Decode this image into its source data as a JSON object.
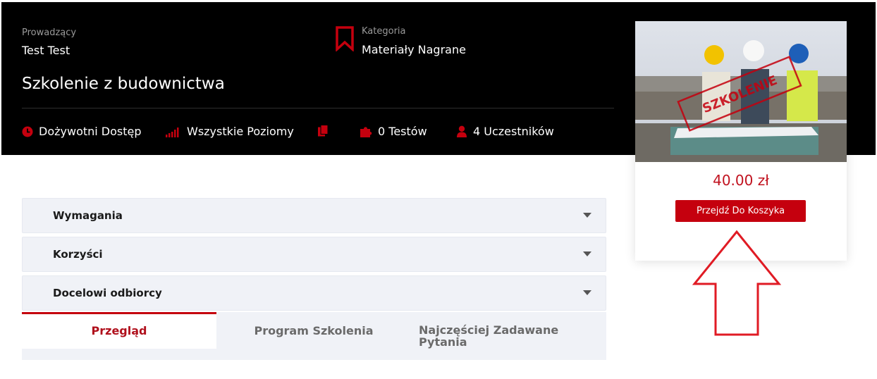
{
  "header": {
    "instructor_label": "Prowadzący",
    "instructor_name": "Test Test",
    "category_label": "Kategoria",
    "category_value": "Materiały Nagrane",
    "course_title": "Szkolenie z budownictwa",
    "meta": {
      "access": "Dożywotni Dostęp",
      "levels": "Wszystkie Poziomy",
      "tests": "0 Testów",
      "participants": "4 Uczestników"
    },
    "accent_color": "#c5000e"
  },
  "card": {
    "stamp_text": "SZKOLENIE",
    "price": "40.00 zł",
    "cart_button": "Przejdź Do Koszyka"
  },
  "accordion": [
    {
      "label": "Wymagania"
    },
    {
      "label": "Korzyści"
    },
    {
      "label": "Docelowi odbiorcy"
    }
  ],
  "tabs": [
    {
      "label": "Przegląd",
      "active": true
    },
    {
      "label": "Program Szkolenia",
      "active": false
    },
    {
      "label": "Najczęściej Zadawane Pytania",
      "active": false
    }
  ],
  "icons": [
    "clock-icon",
    "signal-bars-icon",
    "copy-icon",
    "puzzle-icon",
    "user-icon",
    "bookmark-icon",
    "caret-down-icon",
    "up-arrow-annotation"
  ]
}
